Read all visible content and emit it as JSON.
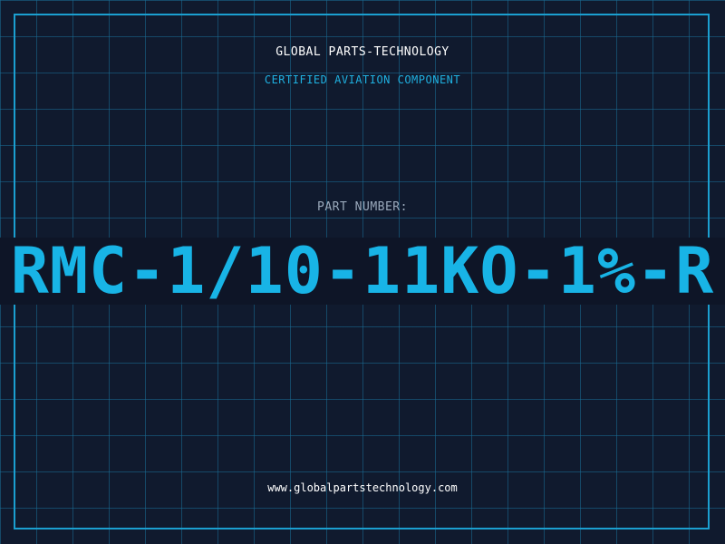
{
  "header": {
    "company_name": "GLOBAL PARTS-TECHNOLOGY",
    "tagline": "CERTIFIED AVIATION COMPONENT"
  },
  "part": {
    "label": "PART NUMBER:",
    "number": "RMC-1/10-11KO-1%-R"
  },
  "footer": {
    "website": "www.globalpartstechnology.com"
  },
  "colors": {
    "background": "#101a2e",
    "grid": "#1a6e96",
    "accent": "#18b4e6",
    "label": "#9aa9bb",
    "text": "#ffffff"
  }
}
